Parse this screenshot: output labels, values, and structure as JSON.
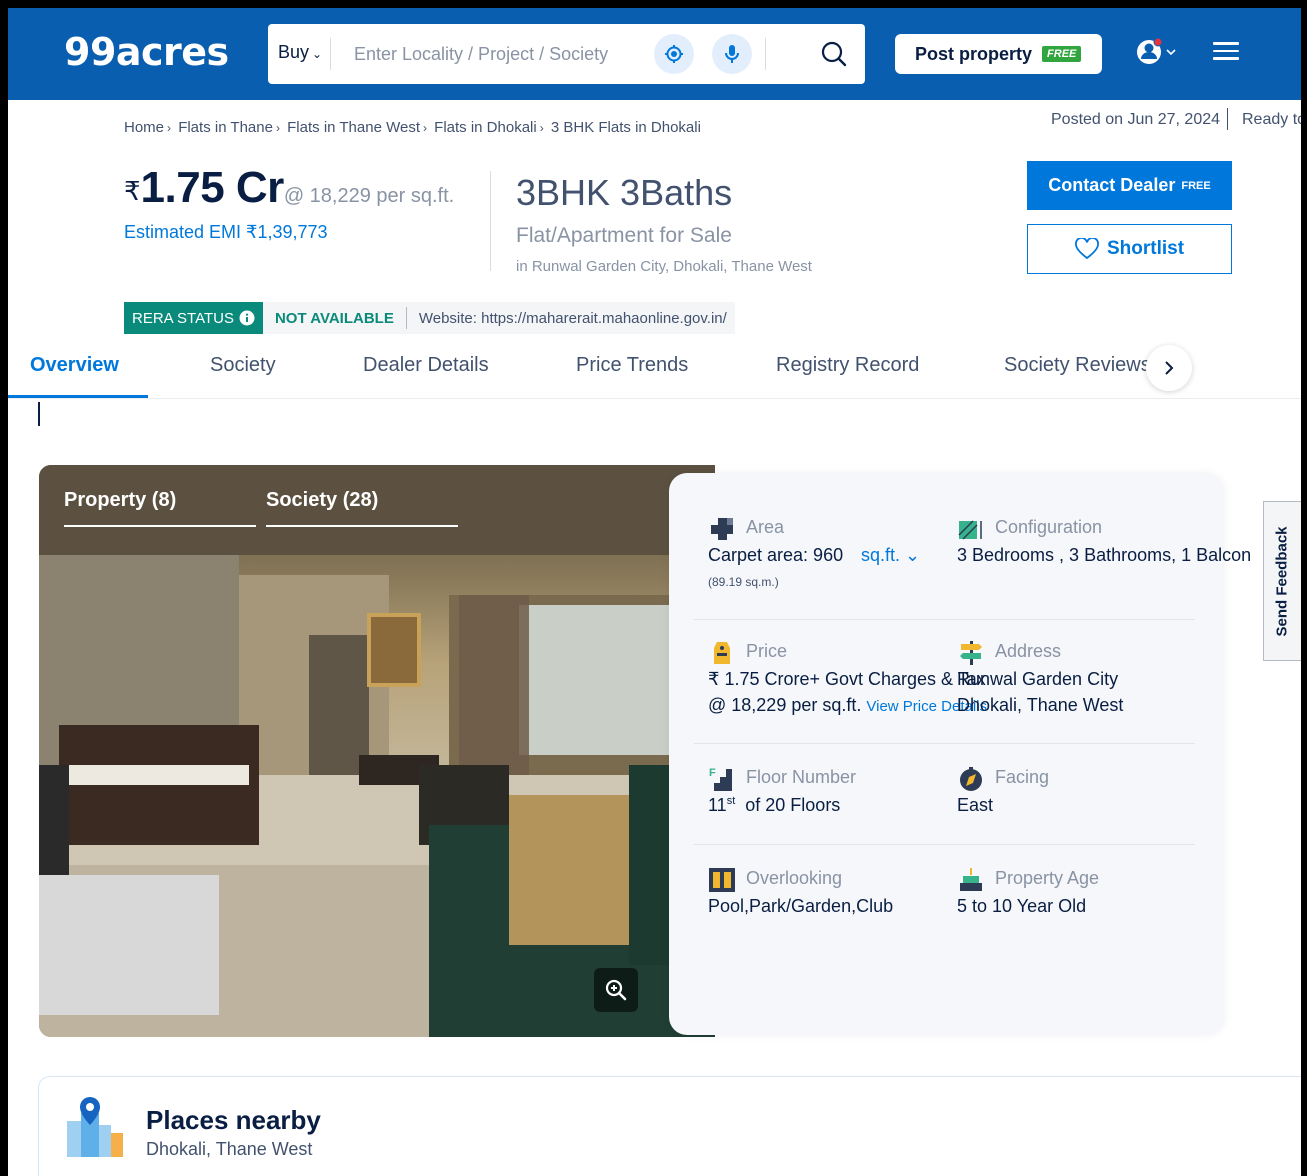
{
  "header": {
    "logo": "99acres",
    "search": {
      "mode": "Buy",
      "placeholder": "Enter Locality / Project / Society"
    },
    "post_property": "Post property",
    "post_property_tag": "FREE",
    "colors": {
      "header_bg": "#0a5eb0",
      "accent": "#0078db",
      "rera": "#0a8a7a"
    }
  },
  "breadcrumb": [
    "Home",
    "Flats in Thane",
    "Flats in Thane West",
    "Flats in Dhokali",
    "3 BHK Flats in Dhokali"
  ],
  "meta": {
    "posted_on": "Posted on Jun 27, 2024",
    "status": "Ready to"
  },
  "price": {
    "currency": "₹",
    "amount": "1.75 Cr",
    "per_sqft": "@ 18,229 per sq.ft.",
    "emi": "Estimated EMI ₹1,39,773"
  },
  "title": {
    "config": "3BHK 3Baths",
    "type": "Flat/Apartment for Sale",
    "location": "in Runwal Garden City, Dhokali, Thane West"
  },
  "actions": {
    "contact": "Contact Dealer",
    "contact_tag": "FREE",
    "shortlist": "Shortlist"
  },
  "rera": {
    "label": "RERA STATUS",
    "value": "NOT AVAILABLE",
    "website": "Website: https://maharerait.mahaonline.gov.in/"
  },
  "tabs": [
    "Overview",
    "Society",
    "Dealer Details",
    "Price Trends",
    "Registry Record",
    "Society Reviews"
  ],
  "gallery": {
    "tab_property": "Property (8)",
    "tab_society": "Society (28)"
  },
  "details": {
    "area": {
      "label": "Area",
      "value": "Carpet area: 960",
      "unit": "sq.ft.",
      "sub": "(89.19 sq.m.)"
    },
    "configuration": {
      "label": "Configuration",
      "value": "3 Bedrooms , 3 Bathrooms, 1 Balcon"
    },
    "price": {
      "label": "Price",
      "value": "₹ 1.75 Crore+ Govt Charges & Tax",
      "value2": "@ 18,229 per sq.ft.",
      "link": "View Price Details"
    },
    "address": {
      "label": "Address",
      "value": "Runwal Garden City",
      "value2": "Dhokali, Thane West"
    },
    "floor": {
      "label": "Floor Number",
      "floor": "11",
      "suffix": "st",
      "value": "of 20 Floors"
    },
    "facing": {
      "label": "Facing",
      "value": "East"
    },
    "overlooking": {
      "label": "Overlooking",
      "value": "Pool,Park/Garden,Club"
    },
    "age": {
      "label": "Property Age",
      "value": "5 to 10 Year Old"
    }
  },
  "feedback": "Send Feedback",
  "places": {
    "title": "Places nearby",
    "subtitle": "Dhokali, Thane West"
  }
}
